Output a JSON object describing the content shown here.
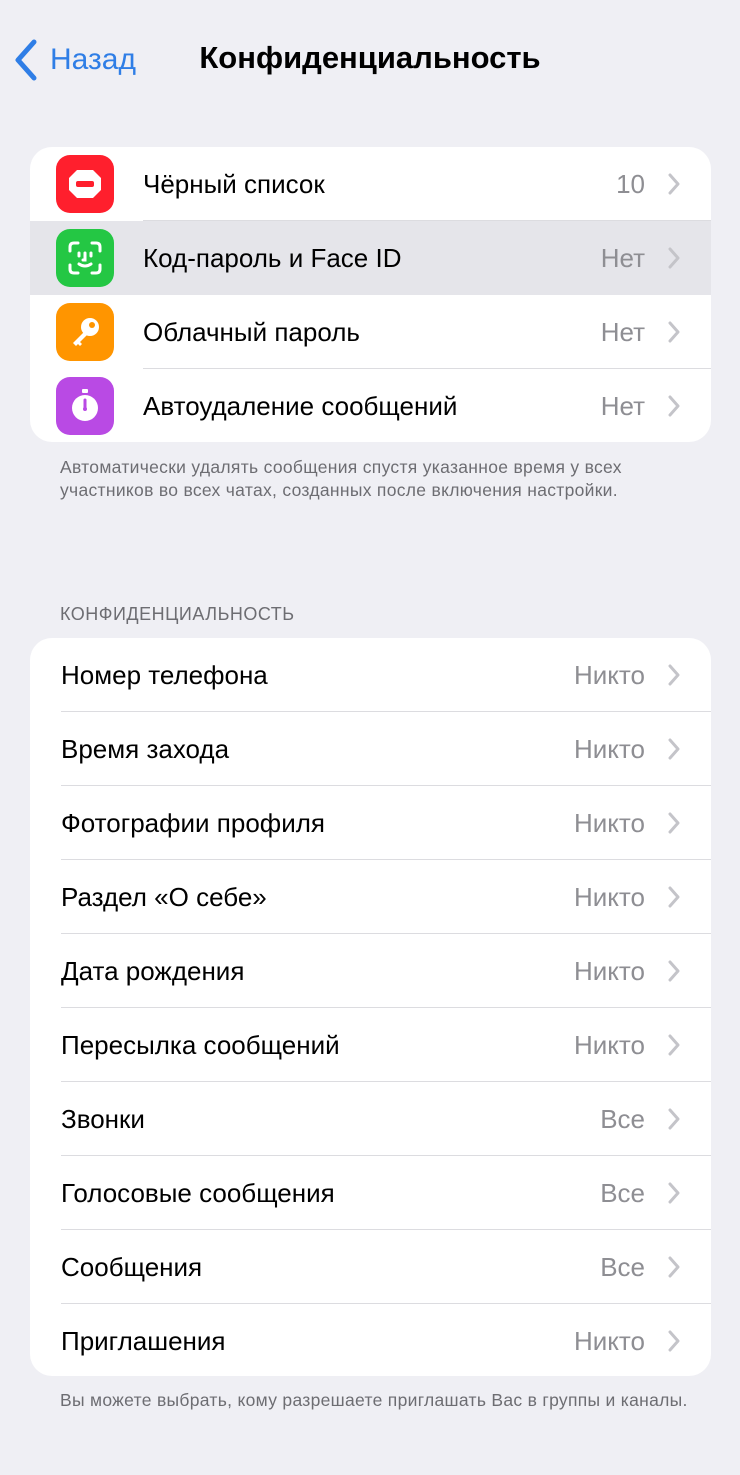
{
  "nav": {
    "back_label": "Назад",
    "title": "Конфиденциальность"
  },
  "security": {
    "items": [
      {
        "label": "Чёрный список",
        "value": "10",
        "icon": "blocked-icon",
        "color": "#ff1f2d"
      },
      {
        "label": "Код-пароль и Face ID",
        "value": "Нет",
        "icon": "face-id-icon",
        "color": "#24c744"
      },
      {
        "label": "Облачный пароль",
        "value": "Нет",
        "icon": "key-icon",
        "color": "#ff9500"
      },
      {
        "label": "Автоудаление сообщений",
        "value": "Нет",
        "icon": "timer-icon",
        "color": "#b94ae4"
      }
    ],
    "footer": "Автоматически удалять сообщения спустя указанное время у всех участников во всех чатах, созданных после включения настройки."
  },
  "privacy": {
    "header": "КОНФИДЕНЦИАЛЬНОСТЬ",
    "items": [
      {
        "label": "Номер телефона",
        "value": "Никто"
      },
      {
        "label": "Время захода",
        "value": "Никто"
      },
      {
        "label": "Фотографии профиля",
        "value": "Никто"
      },
      {
        "label": "Раздел «О себе»",
        "value": "Никто"
      },
      {
        "label": "Дата рождения",
        "value": "Никто"
      },
      {
        "label": "Пересылка сообщений",
        "value": "Никто"
      },
      {
        "label": "Звонки",
        "value": "Все"
      },
      {
        "label": "Голосовые сообщения",
        "value": "Все"
      },
      {
        "label": "Сообщения",
        "value": "Все"
      },
      {
        "label": "Приглашения",
        "value": "Никто"
      }
    ],
    "footer": "Вы можете выбрать, кому разрешаете приглашать Вас в группы и каналы."
  },
  "colors": {
    "accent": "#2f7ee6",
    "background": "#efeff4",
    "secondary_text": "#8e8e93"
  }
}
